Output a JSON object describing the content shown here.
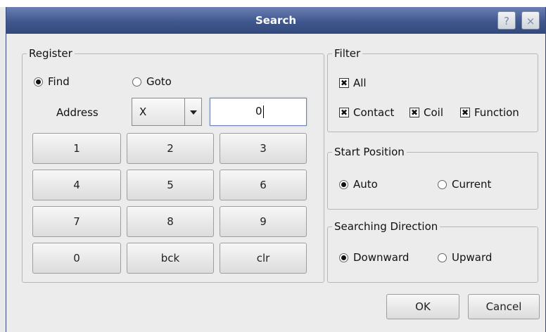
{
  "window": {
    "title": "Search",
    "help_glyph": "?",
    "close_glyph": "×"
  },
  "register": {
    "label": "Register",
    "mode_find": "Find",
    "mode_goto": "Goto",
    "selected_mode": "find",
    "address_label": "Address",
    "address_type": "X",
    "address_value": "0",
    "keys": [
      "1",
      "2",
      "3",
      "4",
      "5",
      "6",
      "7",
      "8",
      "9",
      "0",
      "bck",
      "clr"
    ]
  },
  "filter": {
    "label": "Filter",
    "items": [
      {
        "label": "All",
        "checked": true
      },
      {
        "label": "Contact",
        "checked": true
      },
      {
        "label": "Coil",
        "checked": true
      },
      {
        "label": "Function",
        "checked": true
      }
    ]
  },
  "start_position": {
    "label": "Start Position",
    "auto": "Auto",
    "current": "Current",
    "selected": "auto"
  },
  "direction": {
    "label": "Searching Direction",
    "downward": "Downward",
    "upward": "Upward",
    "selected": "downward"
  },
  "actions": {
    "ok": "OK",
    "cancel": "Cancel"
  },
  "icons": {
    "dropdown": "triangle-down",
    "check_mark": "✖"
  }
}
